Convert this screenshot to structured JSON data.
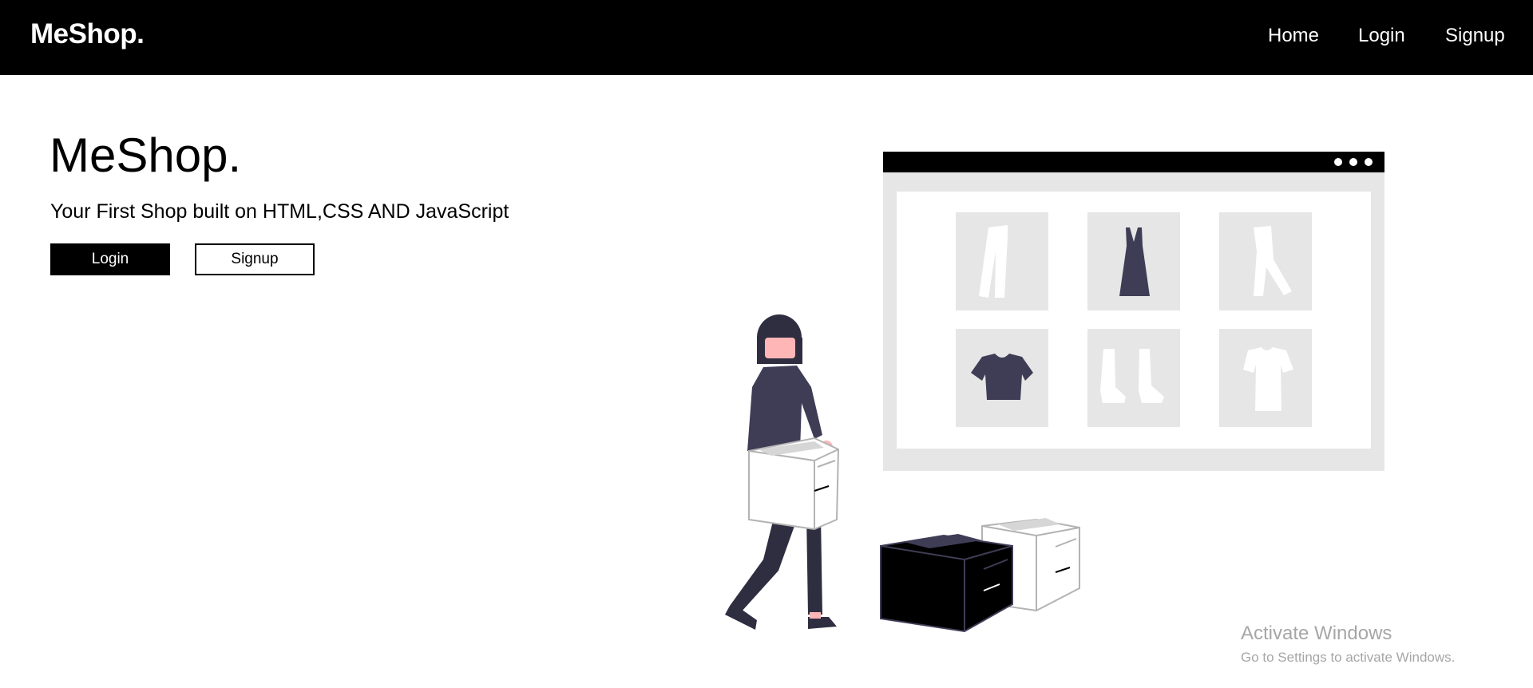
{
  "navbar": {
    "brand": "MeShop.",
    "links": [
      "Home",
      "Login",
      "Signup"
    ]
  },
  "hero": {
    "title": "MeShop.",
    "subtitle": "Your First Shop built on HTML,CSS AND JavaScript",
    "login_label": "Login",
    "signup_label": "Signup"
  },
  "illustration": {
    "name": "online-shopping-illustration",
    "colors": {
      "dark": "#3f3d56",
      "panel": "#e6e6e6",
      "skin": "#ffb6b6",
      "black": "#000000"
    }
  },
  "watermark": {
    "title": "Activate Windows",
    "subtitle": "Go to Settings to activate Windows."
  },
  "colors": {
    "navbar_bg": "#000000",
    "primary_button_bg": "#000000",
    "text": "#000000"
  }
}
